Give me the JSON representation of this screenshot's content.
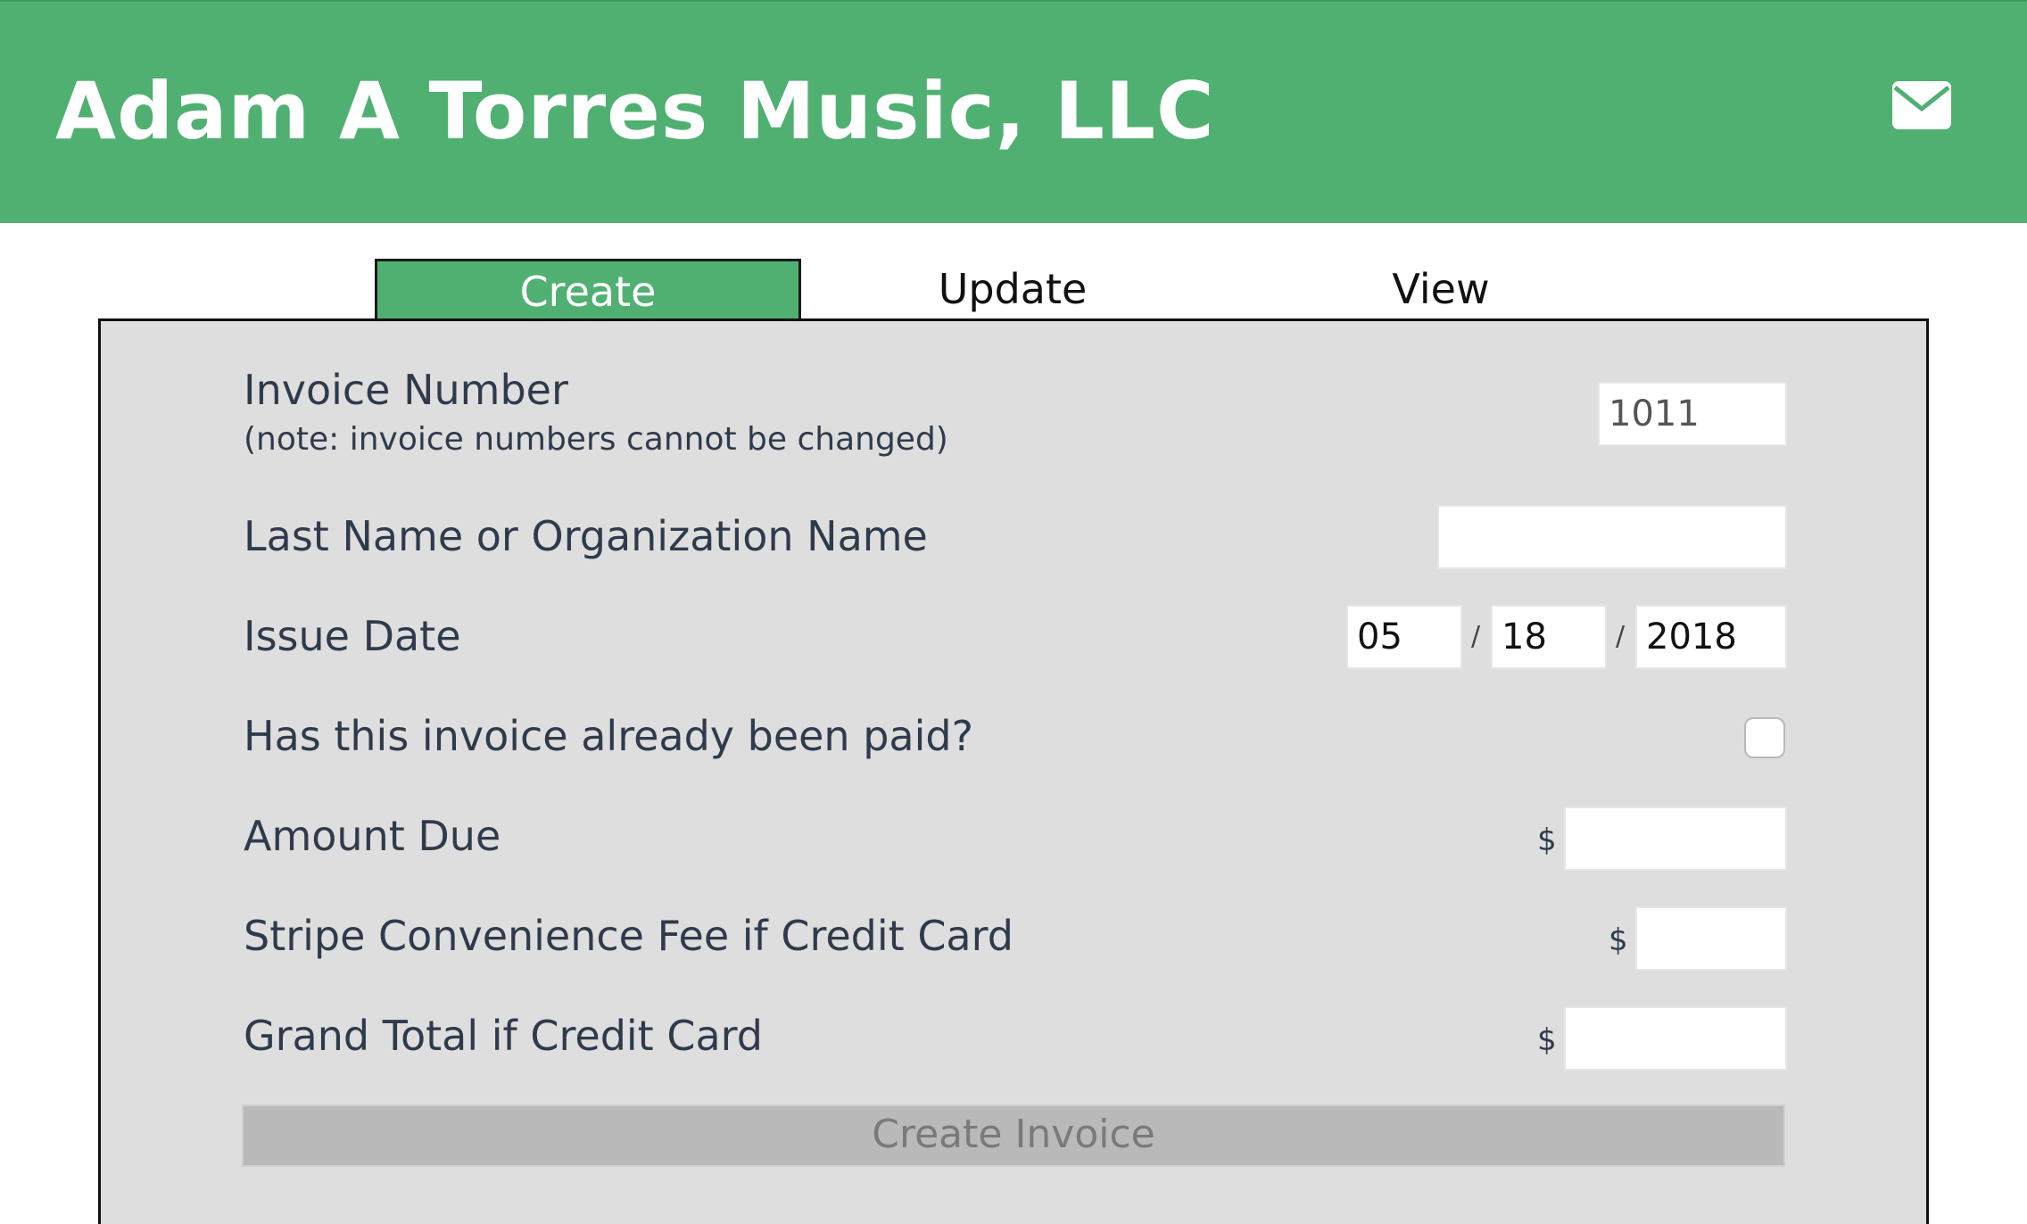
{
  "header": {
    "brand_title": "Adam A Torres Music, LLC",
    "mail_icon": "envelope-icon",
    "colors": {
      "header_bg": "#50b072",
      "title_text": "#ffffff"
    }
  },
  "tabs": [
    {
      "label": "Create",
      "active": true
    },
    {
      "label": "Update",
      "active": false
    },
    {
      "label": "View",
      "active": false
    }
  ],
  "form": {
    "invoice_number": {
      "label": "Invoice Number",
      "note": "(note: invoice numbers cannot be changed)",
      "value": "1011"
    },
    "last_name": {
      "label": "Last Name or Organization Name",
      "value": ""
    },
    "issue_date": {
      "label": "Issue Date",
      "month": "05",
      "day": "18",
      "year": "2018",
      "separator": "/"
    },
    "paid": {
      "label": "Has this invoice already been paid?",
      "checked": false
    },
    "amount_due": {
      "label": "Amount Due",
      "currency": "$",
      "value": ""
    },
    "stripe_fee": {
      "label": "Stripe Convenience Fee if Credit Card",
      "currency": "$",
      "value": ""
    },
    "grand_total": {
      "label": "Grand Total if Credit Card",
      "currency": "$",
      "value": ""
    },
    "submit_label": "Create Invoice"
  }
}
